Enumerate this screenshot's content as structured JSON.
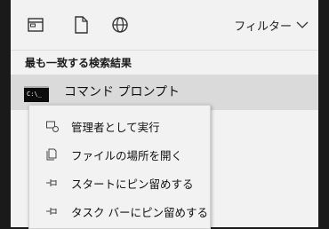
{
  "toolbar": {
    "icons": [
      "app-window-icon",
      "document-icon",
      "globe-icon"
    ],
    "filter_label": "フィルター"
  },
  "section": {
    "header": "最も一致する検索結果"
  },
  "best_match": {
    "title": "コマンド プロンプト",
    "icon_text": "C:\\_"
  },
  "context_menu": {
    "items": [
      {
        "label": "管理者として実行",
        "icon": "run-as-admin-icon"
      },
      {
        "label": "ファイルの場所を開く",
        "icon": "open-file-location-icon"
      },
      {
        "label": "スタートにピン留めする",
        "icon": "pin-icon"
      },
      {
        "label": "タスク バーにピン留めする",
        "icon": "pin-icon"
      }
    ]
  }
}
